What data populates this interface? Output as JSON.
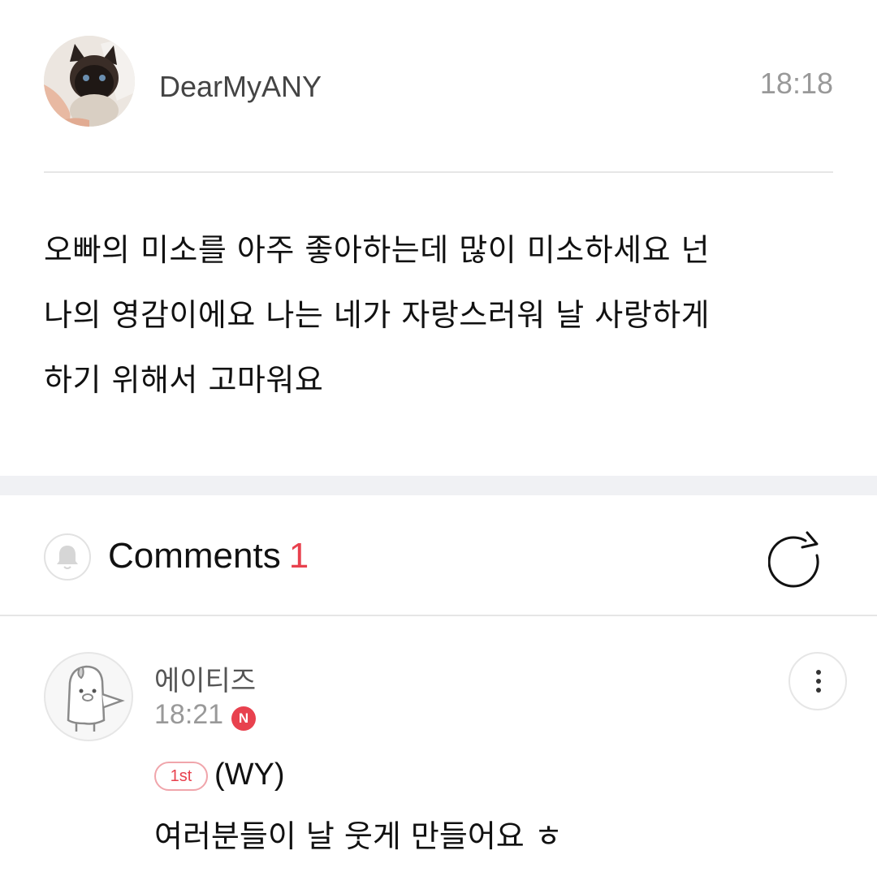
{
  "post": {
    "author": "DearMyANY",
    "time": "18:18",
    "body_lines": [
      "오빠의 미소를 아주 좋아하는데 많이 미소하세요 넌",
      "나의 영감이에요 나는 네가 자랑스러워 날 사랑하게",
      "하기 위해서 고마워요"
    ]
  },
  "comments_section": {
    "title": "Comments",
    "count": "1"
  },
  "comment": {
    "author": "에이티즈",
    "time": "18:21",
    "new_badge": "N",
    "rank_badge": "1st",
    "tag": "(WY)",
    "text": "여러분들이 날 웃게 만들어요 ㅎ"
  },
  "colors": {
    "accent": "#e8414e",
    "divider": "#e6e6e6",
    "section_gap": "#f0f1f4",
    "muted_text": "#999999"
  },
  "icons": {
    "avatar": "cat-photo-avatar",
    "bell": "bell-icon",
    "refresh": "refresh-icon",
    "comment_avatar": "character-avatar",
    "more": "more-vertical-icon"
  }
}
